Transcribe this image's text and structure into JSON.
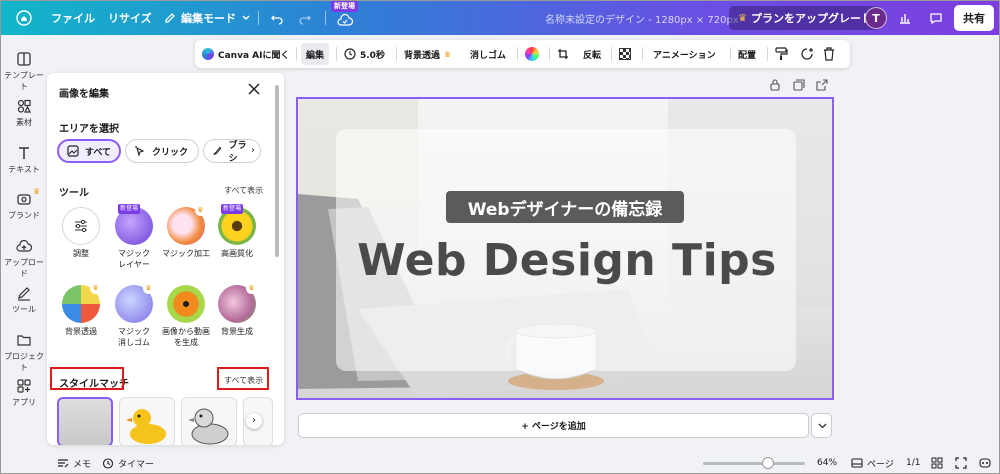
{
  "topbar": {
    "file": "ファイル",
    "resize": "リサイズ",
    "edit_mode": "編集モード",
    "new_badge": "新登場",
    "doc_title": "名称未設定のデザイン - 1280px × 720px",
    "upgrade": "プランをアップグレード",
    "avatar_initial": "T",
    "share": "共有"
  },
  "rail": {
    "items": [
      "テンプレート",
      "素材",
      "テキスト",
      "ブランド",
      "アップロード",
      "ツール",
      "プロジェクト",
      "アプリ"
    ]
  },
  "context_toolbar": {
    "ai": "Canva AIに聞く",
    "edit": "編集",
    "duration": "5.0秒",
    "bg_remove": "背景透過",
    "eraser": "消しゴム",
    "flip": "反転",
    "animation": "アニメーション",
    "arrange": "配置"
  },
  "panel": {
    "title": "画像を編集",
    "select_area": "エリアを選択",
    "chips": [
      "すべて",
      "クリック",
      "ブラシ"
    ],
    "tools_title": "ツール",
    "see_all": "すべて表示",
    "tools": [
      {
        "label": "調整",
        "badge": ""
      },
      {
        "label": "マジック\nレイヤー",
        "badge": "新登場"
      },
      {
        "label": "マジック加工",
        "badge": ""
      },
      {
        "label": "高画質化",
        "badge": "新登場"
      },
      {
        "label": "背景透過",
        "badge": ""
      },
      {
        "label": "マジック\n消しゴム",
        "badge": ""
      },
      {
        "label": "画像から動画\nを生成",
        "badge": ""
      },
      {
        "label": "背景生成",
        "badge": ""
      }
    ],
    "style_match": "スタイルマッチ",
    "style_see_all": "すべて表示"
  },
  "canvas": {
    "subtitle": "Webデザイナーの備忘録",
    "title": "Web Design Tips"
  },
  "add_page": "+ ページを追加",
  "bottom": {
    "notes": "メモ",
    "timer": "タイマー",
    "zoom": "64%",
    "zoom_level": 0.64,
    "pages": "ページ",
    "page_count": "1/1"
  },
  "colors": {
    "accent": "#8b5cf6",
    "badge": "#7b3ae6",
    "highlight": "#e01b1b"
  }
}
